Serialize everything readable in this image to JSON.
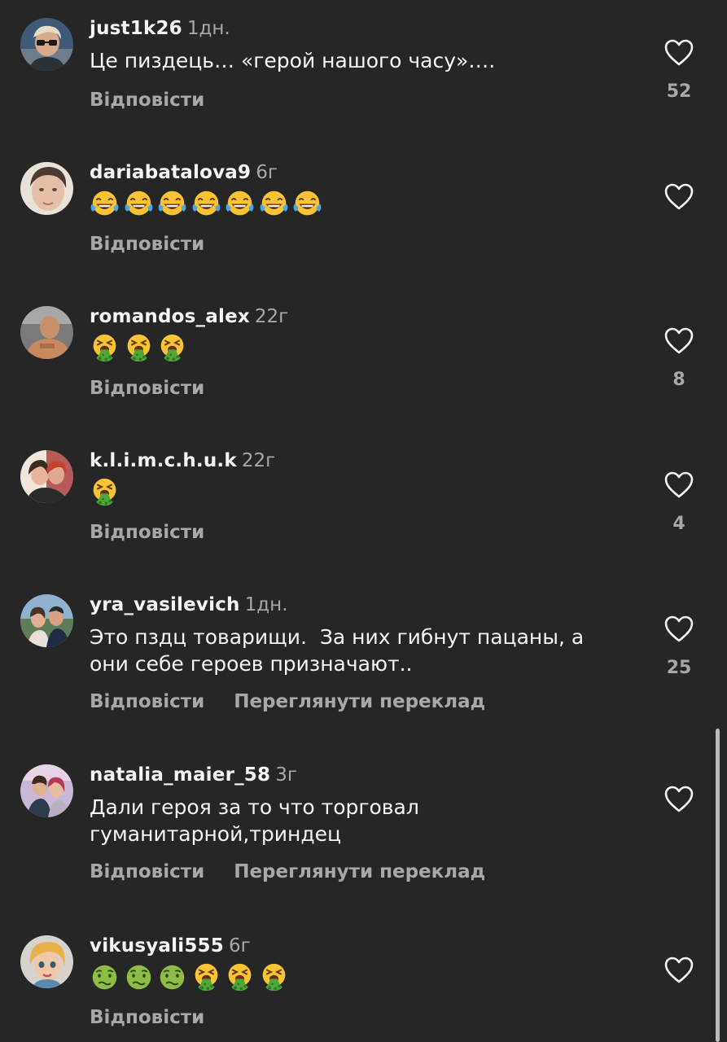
{
  "comments": [
    {
      "username": "just1k26",
      "time": "1дн.",
      "text": "Це пиздець… «герой нашого часу»….",
      "reply_label": "Відповісти",
      "translate_label": "",
      "likes": "52",
      "emojis": []
    },
    {
      "username": "dariabatalova9",
      "time": "6г",
      "text": "😂😂😂😂😂😂😂",
      "reply_label": "Відповісти",
      "translate_label": "",
      "likes": "",
      "emojis": [
        "laugh",
        "laugh",
        "laugh",
        "laugh",
        "laugh",
        "laugh",
        "laugh"
      ]
    },
    {
      "username": "romandos_alex",
      "time": "22г",
      "text": "🤮🤮🤮",
      "reply_label": "Відповісти",
      "translate_label": "",
      "likes": "8",
      "emojis": [
        "vomit",
        "vomit",
        "vomit"
      ]
    },
    {
      "username": "k.l.i.m.c.h.u.k",
      "time": "22г",
      "text": "🤮",
      "reply_label": "Відповісти",
      "translate_label": "",
      "likes": "4",
      "emojis": [
        "vomit"
      ]
    },
    {
      "username": "yra_vasilevich",
      "time": "1дн.",
      "text": "Это пздц товарищи.  За них гибнут пацаны, а они себе героев призначают..",
      "reply_label": "Відповісти",
      "translate_label": "Переглянути переклад",
      "likes": "25",
      "emojis": []
    },
    {
      "username": "natalia_maier_58",
      "time": "3г",
      "text": "Дали героя за то что торговал гуманитарной,триндец",
      "reply_label": "Відповісти",
      "translate_label": "Переглянути переклад",
      "likes": "",
      "emojis": []
    },
    {
      "username": "vikusyali555",
      "time": "6г",
      "text": "🤢🤢🤢🤮🤮🤮",
      "reply_label": "Відповісти",
      "translate_label": "",
      "likes": "",
      "emojis": [
        "nausea",
        "nausea",
        "nausea",
        "vomit",
        "vomit",
        "vomit"
      ]
    }
  ],
  "colors": {
    "background": "#262626",
    "primary_text": "#f5f5f5",
    "secondary_text": "#a8a8a8"
  },
  "icons": {
    "like": "heart-outline-icon",
    "laugh": "face-with-tears-of-joy-emoji",
    "vomit": "face-vomiting-emoji",
    "nausea": "nauseated-face-emoji"
  }
}
